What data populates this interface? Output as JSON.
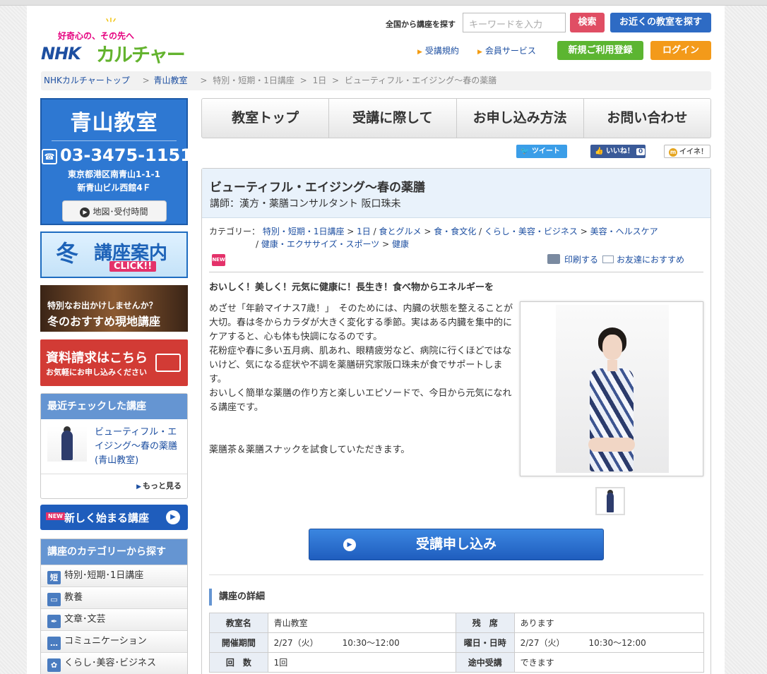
{
  "header": {
    "tagline": "好奇心の、その先へ",
    "logo_nhk": "NHK",
    "logo_culture": "カルチャー",
    "search_label": "全国から講座を探す",
    "search_placeholder": "キーワードを入力",
    "search_button": "検索",
    "nearby_button": "お近くの教室を探す",
    "links": [
      "受講規約",
      "会員サービス"
    ],
    "register_button": "新規ご利用登録",
    "login_button": "ログイン"
  },
  "breadcrumb": {
    "items": [
      "NHKカルチャートップ",
      "青山教室",
      "特別・短期・1日講座",
      "1日",
      "ビューティフル・エイジング～春の薬膳"
    ]
  },
  "sidebar": {
    "school_name": "青山教室",
    "phone": "03-3475-1151",
    "address_line1": "東京都港区南青山1-1-1",
    "address_line2": "新青山ビル西館4Ｆ",
    "map_button": "地図･受付時間",
    "winter_banner": {
      "big": "冬",
      "big2": "講座案内",
      "click": "CLICK!!"
    },
    "trip_banner": {
      "line1": "特別なお出かけしませんか？",
      "line2": "冬のおすすめ現地講座"
    },
    "doc_banner": {
      "line1": "資料請求はこちら",
      "line2": "お気軽にお申し込みください"
    },
    "recent": {
      "heading": "最近チェックした講座",
      "title": "ビューティフル・エイジング～春の薬膳(青山教室)",
      "more": "もっと見る"
    },
    "new_courses": {
      "tag": "NEW",
      "label": "新しく始まる講座"
    },
    "categories": {
      "heading": "講座のカテゴリーから探す",
      "items": [
        {
          "icon": "短",
          "label": "特別･短期･1日講座"
        },
        {
          "icon": "▭",
          "label": "教養"
        },
        {
          "icon": "✒",
          "label": "文章･文芸"
        },
        {
          "icon": "…",
          "label": "コミュニケーション"
        },
        {
          "icon": "✿",
          "label": "くらし･美容･ビジネス"
        }
      ]
    }
  },
  "nav": {
    "tabs": [
      "教室トップ",
      "受講に際して",
      "お申し込み方法",
      "お問い合わせ"
    ]
  },
  "social": {
    "tweet": "ツイート",
    "like": "いいね！",
    "like_count": "0",
    "iine": "イイネ！"
  },
  "course": {
    "title": "ビューティフル・エイジング～春の薬膳",
    "lecturer": "講師：漢方・薬膳コンサルタント 阪口珠未",
    "category_label": "カテゴリー：",
    "category_line1": [
      "特別・短期・1日講座",
      "1日",
      "食とグルメ",
      "食・食文化",
      "くらし・美容・ビジネス",
      "美容・ヘルスケア"
    ],
    "category_line2": [
      "健康・エクササイズ・スポーツ",
      "健康"
    ],
    "new_tag": "NEW",
    "print": "印刷する",
    "recommend": "お友達におすすめ",
    "catchphrase": "おいしく！美しく！元気に健康に！長生き！食べ物からエネルギーを",
    "description": [
      "めざせ「年齢マイナス7歳！」　そのためには、内臓の状態を整えることが大切。春は冬からカラダが大きく変化する季節。実はある内臓を集中的にケアすると、心も体も快調になるのです。",
      "花粉症や春に多い五月病、肌あれ、眼精疲労など、病院に行くほどではないけど、気になる症状や不調を薬膳研究家阪口珠未が食でサポートします。",
      "おいしく簡単な薬膳の作り方と楽しいエピソードで、今日から元気になれる講座です。",
      "薬膳茶＆薬膳スナックを試食していただきます。"
    ],
    "apply_button": "受講申し込み",
    "details_heading": "講座の詳細",
    "details": {
      "school_key": "教室名",
      "school_val": "青山教室",
      "seats_key": "残　席",
      "seats_val": "あります",
      "period_key": "開催期間",
      "period_date": "2/27（火）",
      "period_time": "10:30～12:00",
      "day_key": "曜日・日時",
      "day_date": "2/27（火）",
      "day_time": "10:30～12:00",
      "count_key": "回　数",
      "count_val": "1回",
      "mid_key": "途中受講",
      "mid_val": "できます"
    }
  },
  "colors": {
    "accent_blue": "#2e78d2",
    "link": "#1d4fa1",
    "search_red": "#e04e64",
    "register_green": "#5cb531",
    "login_orange": "#f39a1a"
  }
}
